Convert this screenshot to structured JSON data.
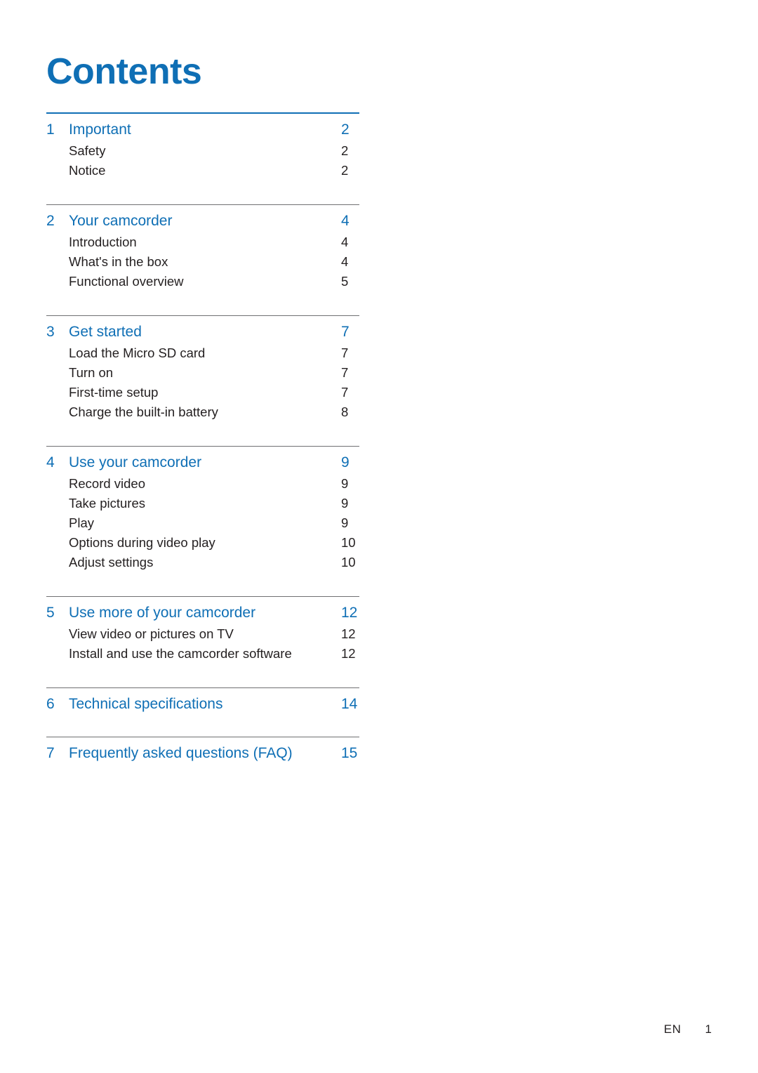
{
  "document": {
    "title": "Contents",
    "accent_color": "#0f6fb5",
    "text_color": "#231f20"
  },
  "toc": {
    "chapters": [
      {
        "num": "1",
        "label": "Important",
        "page": "2",
        "items": [
          {
            "label": "Safety",
            "page": "2"
          },
          {
            "label": "Notice",
            "page": "2"
          }
        ]
      },
      {
        "num": "2",
        "label": "Your camcorder",
        "page": "4",
        "items": [
          {
            "label": "Introduction",
            "page": "4"
          },
          {
            "label": "What's in the box",
            "page": "4"
          },
          {
            "label": "Functional overview",
            "page": "5"
          }
        ]
      },
      {
        "num": "3",
        "label": "Get started",
        "page": "7",
        "items": [
          {
            "label": "Load the Micro SD card",
            "page": "7"
          },
          {
            "label": "Turn on",
            "page": "7"
          },
          {
            "label": "First-time setup",
            "page": "7"
          },
          {
            "label": "Charge the built-in battery",
            "page": "8"
          }
        ]
      },
      {
        "num": "4",
        "label": "Use your camcorder",
        "page": "9",
        "items": [
          {
            "label": "Record video",
            "page": "9"
          },
          {
            "label": "Take pictures",
            "page": "9"
          },
          {
            "label": "Play",
            "page": "9"
          },
          {
            "label": "Options during video play",
            "page": "10"
          },
          {
            "label": "Adjust settings",
            "page": "10"
          }
        ]
      },
      {
        "num": "5",
        "label": "Use more of your camcorder",
        "page": "12",
        "items": [
          {
            "label": "View video or pictures on TV",
            "page": "12"
          },
          {
            "label": "Install and use the camcorder software",
            "page": "12"
          }
        ]
      },
      {
        "num": "6",
        "label": "Technical specifications",
        "page": "14",
        "items": []
      },
      {
        "num": "7",
        "label": "Frequently asked questions (FAQ)",
        "page": "15",
        "items": []
      }
    ]
  },
  "footer": {
    "language": "EN",
    "page_number": "1"
  }
}
